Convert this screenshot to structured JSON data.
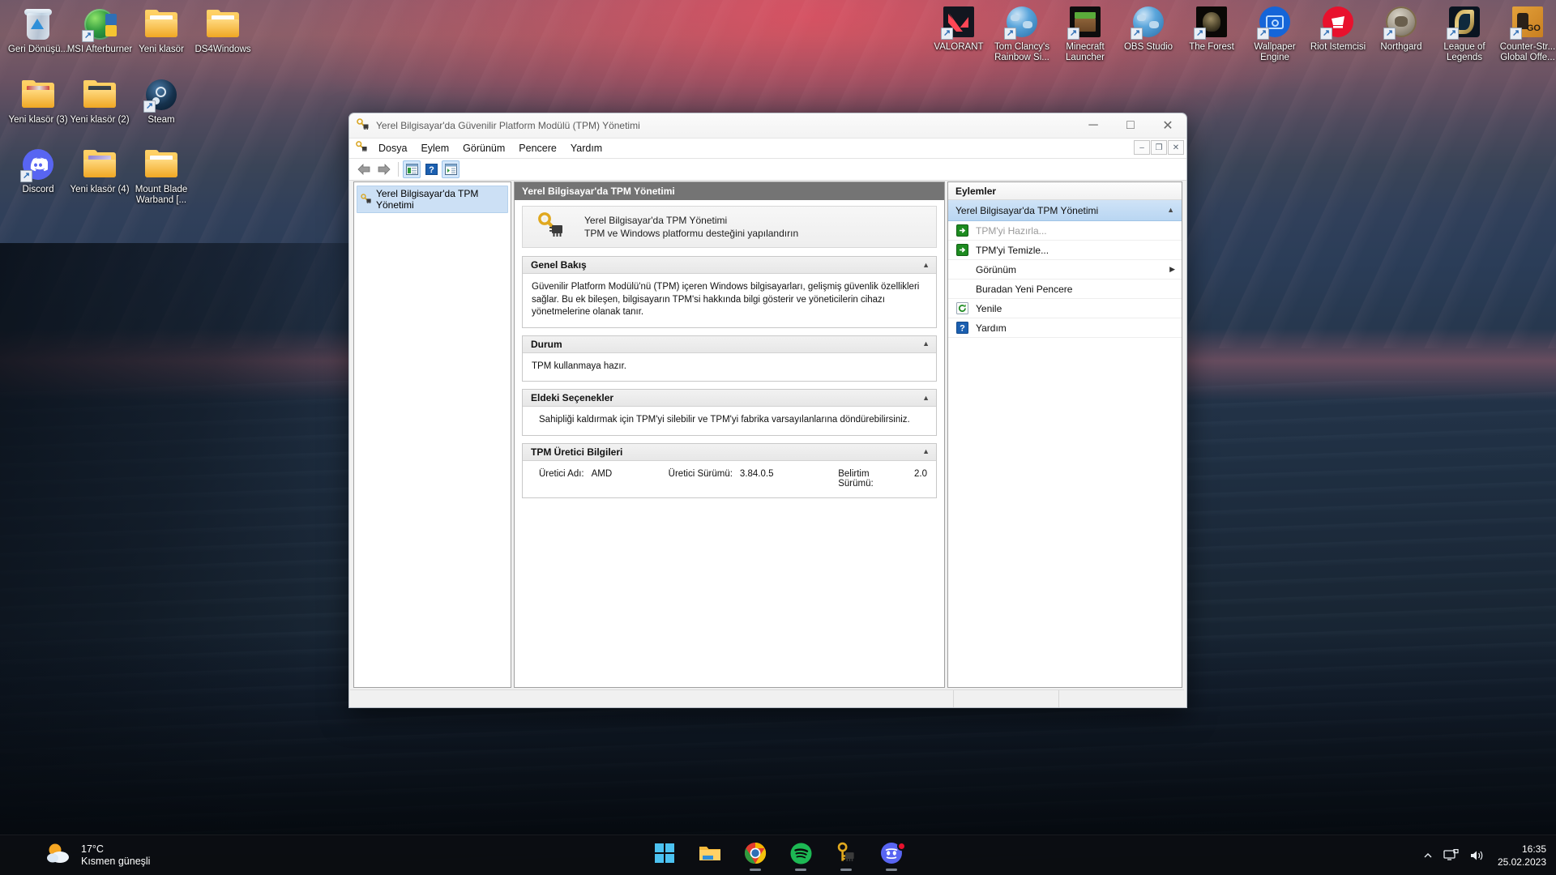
{
  "desktop": {
    "left_icons": [
      {
        "label": "Geri Dönüşü...",
        "icon": "recycle-bin-icon"
      },
      {
        "label": "MSI Afterburner",
        "icon": "msi-afterburner-icon"
      },
      {
        "label": "Yeni klasör",
        "icon": "folder-icon"
      },
      {
        "label": "DS4Windows",
        "icon": "folder-icon"
      },
      {
        "label": "Yeni klasör (3)",
        "icon": "folder-icon"
      },
      {
        "label": "Yeni klasör (2)",
        "icon": "folder-icon"
      },
      {
        "label": "Steam",
        "icon": "steam-icon"
      },
      {
        "label": "Discord",
        "icon": "discord-icon"
      },
      {
        "label": "Yeni klasör (4)",
        "icon": "folder-icon"
      },
      {
        "label": "Mount Blade Warband [...",
        "icon": "folder-icon"
      }
    ],
    "right_icons": [
      {
        "label": "VALORANT",
        "icon": "valorant-icon"
      },
      {
        "label": "Tom Clancy's Rainbow Si...",
        "icon": "web-shortcut-icon"
      },
      {
        "label": "Minecraft Launcher",
        "icon": "minecraft-icon"
      },
      {
        "label": "OBS Studio",
        "icon": "web-shortcut-icon"
      },
      {
        "label": "The Forest",
        "icon": "the-forest-icon"
      },
      {
        "label": "Wallpaper Engine",
        "icon": "wallpaper-engine-icon"
      },
      {
        "label": "Riot Istemcisi",
        "icon": "riot-client-icon"
      },
      {
        "label": "Northgard",
        "icon": "northgard-icon"
      },
      {
        "label": "League of Legends",
        "icon": "league-of-legends-icon"
      },
      {
        "label": "Counter-Str... Global Offe...",
        "icon": "csgo-icon"
      }
    ]
  },
  "window": {
    "title": "Yerel Bilgisayar'da Güvenilir Platform Modülü (TPM) Yönetimi",
    "icon": "tpm-key-chip-icon",
    "controls": {
      "minimize": "─",
      "maximize": "□",
      "close": "✕"
    },
    "mdi_controls": {
      "minimize": "–",
      "restore": "❐",
      "close": "✕"
    },
    "menu": [
      {
        "label": "Dosya"
      },
      {
        "label": "Eylem"
      },
      {
        "label": "Görünüm"
      },
      {
        "label": "Pencere"
      },
      {
        "label": "Yardım"
      }
    ],
    "toolbar": [
      {
        "name": "back-button",
        "glyph": "⬅",
        "toggled": false
      },
      {
        "name": "forward-button",
        "glyph": "➡",
        "toggled": false
      },
      {
        "name": "show-console-tree-button",
        "glyph": "▤",
        "toggled": true
      },
      {
        "name": "help-button",
        "glyph": "?",
        "toggled": false
      },
      {
        "name": "show-action-pane-button",
        "glyph": "▥",
        "toggled": true
      }
    ]
  },
  "tree": {
    "nodes": [
      {
        "label": "Yerel Bilgisayar'da TPM Yönetimi",
        "icon": "tpm-key-chip-icon",
        "selected": true
      }
    ]
  },
  "center": {
    "header": "Yerel Bilgisayar'da TPM Yönetimi",
    "banner": {
      "icon": "tpm-key-chip-icon",
      "line1": "Yerel Bilgisayar'da TPM Yönetimi",
      "line2": "TPM ve Windows platformu desteğini yapılandırın"
    },
    "groups": [
      {
        "title": "Genel Bakış",
        "collapse_glyph": "▲",
        "body": "Güvenilir Platform Modülü'nü (TPM) içeren Windows bilgisayarları, gelişmiş güvenlik özellikleri sağlar. Bu ek bileşen, bilgisayarın TPM'si hakkında bilgi gösterir ve yöneticilerin cihazı yönetmelerine olanak tanır."
      },
      {
        "title": "Durum",
        "collapse_glyph": "▲",
        "body": "TPM kullanmaya hazır."
      },
      {
        "title": "Eldeki Seçenekler",
        "collapse_glyph": "▲",
        "body": "Sahipliği kaldırmak için TPM'yi silebilir ve TPM'yi fabrika varsayılanlarına döndürebilirsiniz."
      }
    ],
    "manufacturer": {
      "title": "TPM Üretici Bilgileri",
      "collapse_glyph": "▲",
      "fields": [
        {
          "label": "Üretici Adı:",
          "value": "AMD"
        },
        {
          "label": "Üretici Sürümü:",
          "value": "3.84.0.5"
        },
        {
          "label": "Belirtim Sürümü:",
          "value": "2.0"
        }
      ]
    }
  },
  "actions": {
    "title": "Eylemler",
    "group_header": {
      "label": "Yerel Bilgisayar'da TPM Yönetimi",
      "collapse_glyph": "▲"
    },
    "items": [
      {
        "label": "TPM'yi Hazırla...",
        "icon": "green-arrow-icon",
        "disabled": true,
        "submenu": false
      },
      {
        "label": "TPM'yi Temizle...",
        "icon": "green-arrow-icon",
        "disabled": false,
        "submenu": false
      },
      {
        "label": "Görünüm",
        "icon": "none",
        "disabled": false,
        "submenu": true,
        "submenu_glyph": "▶"
      },
      {
        "label": "Buradan Yeni Pencere",
        "icon": "none",
        "disabled": false,
        "submenu": false
      },
      {
        "label": "Yenile",
        "icon": "refresh-icon",
        "disabled": false,
        "submenu": false
      },
      {
        "label": "Yardım",
        "icon": "help-icon",
        "disabled": false,
        "submenu": false
      }
    ]
  },
  "taskbar": {
    "weather": {
      "icon": "partly-sunny-icon",
      "temperature": "17°C",
      "condition": "Kısmen güneşli"
    },
    "apps": [
      {
        "name": "start-button",
        "icon": "windows-logo-icon",
        "running": false
      },
      {
        "name": "file-explorer-button",
        "icon": "file-explorer-icon",
        "running": false
      },
      {
        "name": "chrome-button",
        "icon": "chrome-icon",
        "running": true
      },
      {
        "name": "spotify-button",
        "icon": "spotify-icon",
        "running": true
      },
      {
        "name": "tpm-button",
        "icon": "tpm-key-chip-icon",
        "running": true
      },
      {
        "name": "discord-button",
        "icon": "discord-icon",
        "running": true,
        "badge": true
      }
    ],
    "tray": {
      "overflow_glyph": "∧",
      "network_icon": "network-icon",
      "volume_icon": "volume-icon"
    },
    "clock": {
      "time": "16:35",
      "date": "25.02.2023"
    }
  },
  "colors": {
    "accent": "#2f6fb5",
    "pane_header_bg": "#747474",
    "action_group_bg": "#bfd8f2",
    "green_arrow": "#1d8b20",
    "taskbar_bg": "#0c0e12"
  }
}
